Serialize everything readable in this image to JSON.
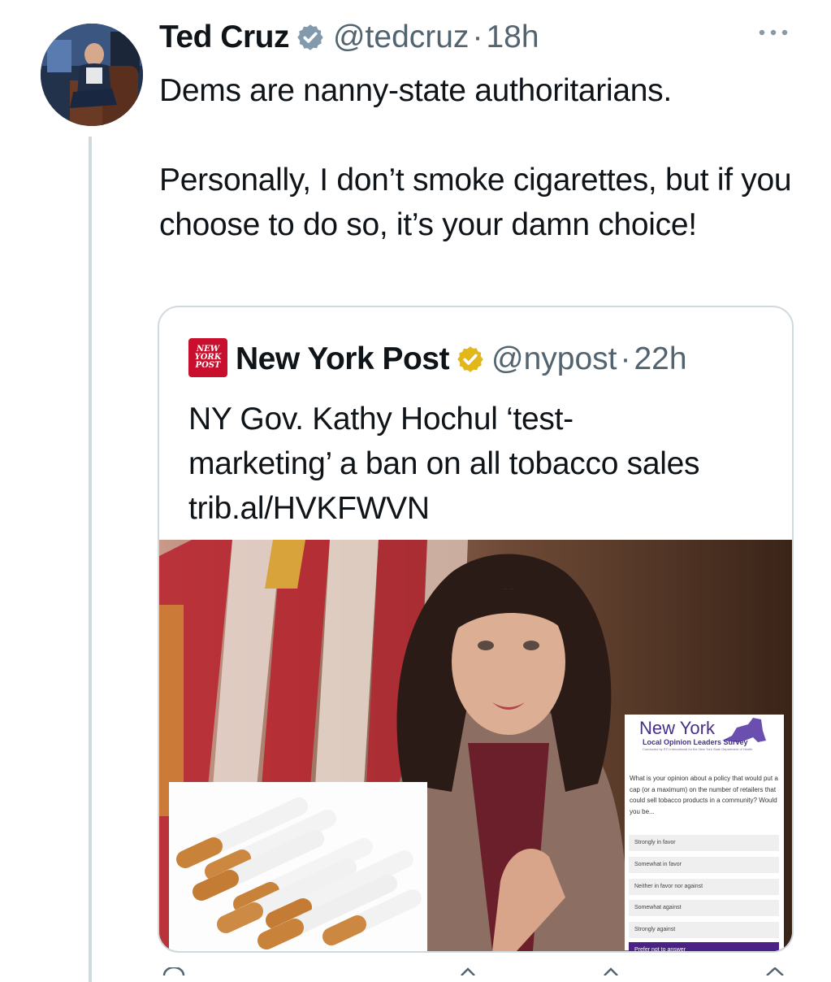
{
  "tweet": {
    "author_name": "Ted Cruz",
    "handle": "@tedcruz",
    "separator": "·",
    "time": "18h",
    "text_paragraphs": [
      "Dems are nanny-state authoritarians.",
      "Personally, I don’t smoke cigarettes, but if you choose to do so, it’s your damn choice!"
    ]
  },
  "quoted_tweet": {
    "logo_lines": [
      "NEW",
      "YORK",
      "POST"
    ],
    "author_name": "New York Post",
    "handle": "@nypost",
    "separator": "·",
    "time": "22h",
    "text": "NY Gov. Kathy Hochul ‘test-marketing’ a ban on all tobacco sales trib.al/HVKFWVN"
  },
  "survey": {
    "title": "New York",
    "subtitle": "Local Opinion Leaders Survey",
    "fine_print": "Conducted by RTI International for the New York State Department of Health",
    "question": "What is your opinion about a policy that would put a cap (or a maximum) on the number of retailers that could sell tobacco products in a community? Would you be...",
    "options": [
      "Strongly in favor",
      "Somewhat in favor",
      "Neither in favor nor against",
      "Somewhat against",
      "Strongly against",
      "Prefer not to answer"
    ],
    "selected_option": "Prefer not to answer"
  },
  "icons": {
    "verified": "verified-badge-icon",
    "org_verified": "gold-verified-badge-icon",
    "more": "more-dots-icon"
  },
  "colors": {
    "verified_blue": "#1d9bf0",
    "org_gold": "#e2b719",
    "secondary_text": "#536471",
    "survey_purple": "#4b2185",
    "nyp_red": "#c8102e"
  }
}
